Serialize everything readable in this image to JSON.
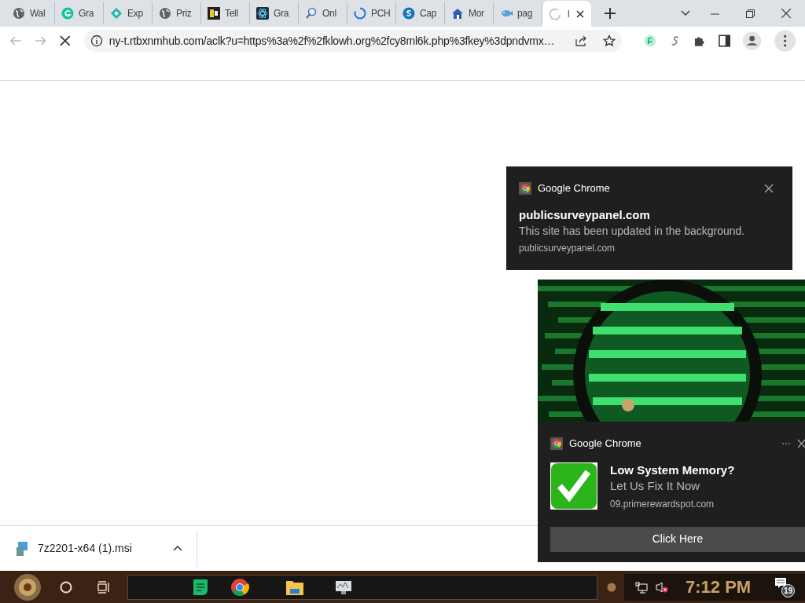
{
  "tabs": [
    {
      "title": "Wal",
      "kind": "globe",
      "selected": false
    },
    {
      "title": "Gra",
      "kind": "green-circle",
      "selected": false
    },
    {
      "title": "Exp",
      "kind": "teal-diamond",
      "selected": false
    },
    {
      "title": "Priz",
      "kind": "globe",
      "selected": false
    },
    {
      "title": "Tell",
      "kind": "dark-square",
      "selected": false
    },
    {
      "title": "Gra",
      "kind": "atom",
      "selected": false
    },
    {
      "title": "Onl",
      "kind": "magnifier",
      "selected": false
    },
    {
      "title": "PCH",
      "kind": "ring",
      "selected": false
    },
    {
      "title": "Cap",
      "kind": "blue-circle",
      "selected": false
    },
    {
      "title": "Mor",
      "kind": "house",
      "selected": false
    },
    {
      "title": "pag",
      "kind": "fish",
      "selected": false
    },
    {
      "title": "l",
      "kind": "spinner",
      "selected": true
    }
  ],
  "loading": true,
  "address_bar": {
    "url": "ny-t.rtbxnmhub.com/aclk?u=https%3a%2f%2fklowh.org%2fcy8ml6k.php%3fkey%3dpndvmx…"
  },
  "notifications": [
    {
      "kind": "simple",
      "app": "Google Chrome",
      "title": "publicsurveypanel.com",
      "message": "This site has been updated in the background.",
      "source": "publicsurveypanel.com"
    },
    {
      "kind": "rich",
      "app": "Google Chrome",
      "title": "Low System Memory?",
      "message": "Let Us Fix It Now",
      "source": "09.primerewardspot.com",
      "button": "Click Here"
    }
  ],
  "download": {
    "filename": "7z2201-x64 (1).msi"
  },
  "taskbar": {
    "clock": "7:12 PM",
    "notification_count": "19",
    "volume_muted": true
  }
}
